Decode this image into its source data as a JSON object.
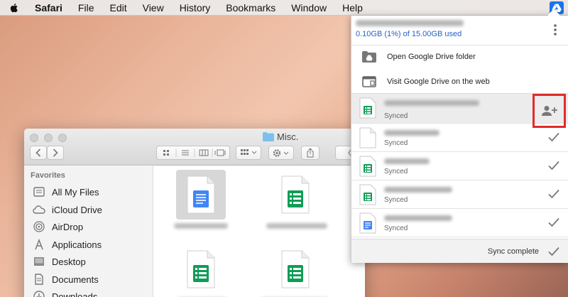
{
  "menubar": {
    "app": "Safari",
    "items": [
      "File",
      "Edit",
      "View",
      "History",
      "Bookmarks",
      "Window",
      "Help"
    ],
    "status_icon": "google-drive-icon"
  },
  "finder": {
    "title": "Misc.",
    "sidebar": {
      "heading": "Favorites",
      "items": [
        {
          "label": "All My Files",
          "icon": "all-files-icon"
        },
        {
          "label": "iCloud Drive",
          "icon": "cloud-icon"
        },
        {
          "label": "AirDrop",
          "icon": "airdrop-icon"
        },
        {
          "label": "Applications",
          "icon": "applications-icon"
        },
        {
          "label": "Desktop",
          "icon": "desktop-icon"
        },
        {
          "label": "Documents",
          "icon": "documents-icon"
        },
        {
          "label": "Downloads",
          "icon": "downloads-icon"
        }
      ]
    }
  },
  "drive": {
    "storage": "0.10GB (1%) of 15.00GB used",
    "actions": [
      {
        "label": "Open Google Drive folder",
        "icon": "drive-folder-icon"
      },
      {
        "label": "Visit Google Drive on the web",
        "icon": "browser-window-icon"
      }
    ],
    "files": [
      {
        "status": "Synced",
        "icon": "sheets-icon"
      },
      {
        "status": "Synced",
        "icon": "image-file-icon"
      },
      {
        "status": "Synced",
        "icon": "sheets-icon"
      },
      {
        "status": "Synced",
        "icon": "sheets-icon"
      },
      {
        "status": "Synced",
        "icon": "docs-icon"
      }
    ],
    "footer": "Sync complete",
    "colors": {
      "accent": "#2462c6",
      "highlight": "#e02b2b",
      "sheets": "#0f9d58",
      "docs": "#4285f4"
    }
  }
}
